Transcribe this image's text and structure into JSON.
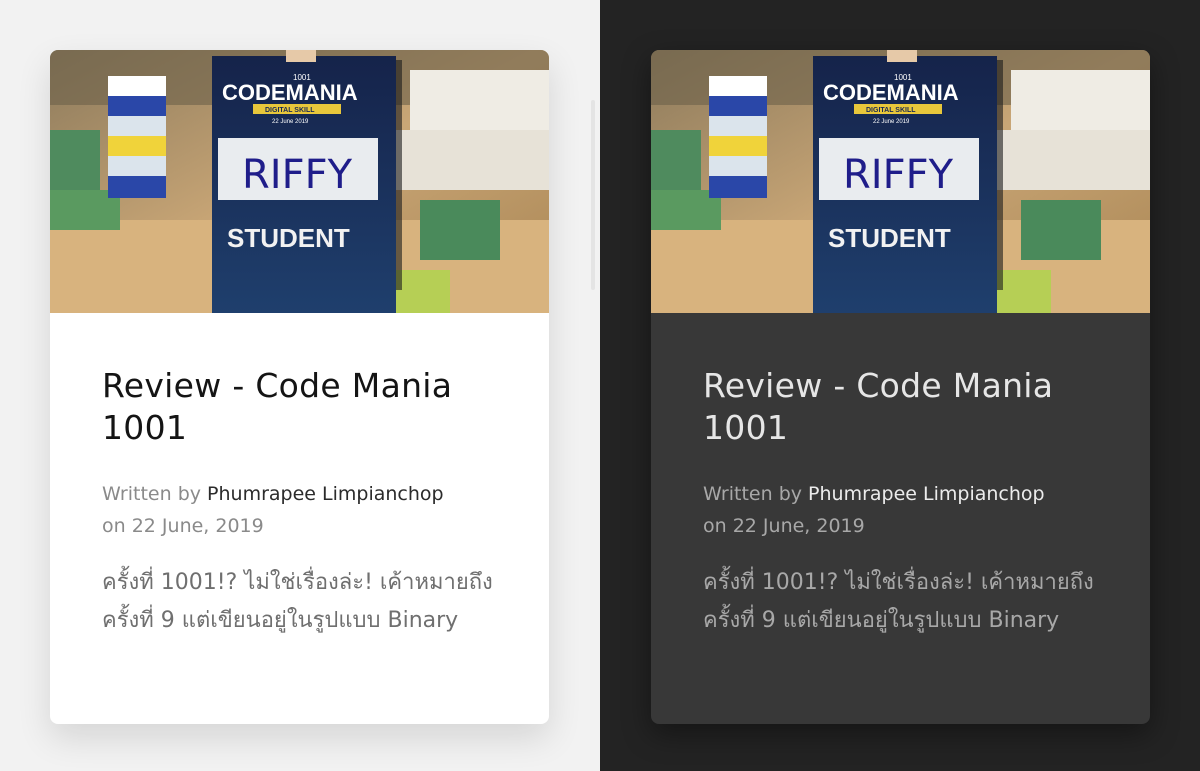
{
  "cards": [
    {
      "theme": "light",
      "image": {
        "badge_top": "1001",
        "badge_brand": "CODEMANIA",
        "badge_tagline": "DIGITAL SKILL",
        "badge_date": "22 June 2019",
        "badge_name": "RIFFY",
        "badge_role": "STUDENT"
      },
      "title": "Review - Code Mania 1001",
      "written_by": "Written by",
      "author": "Phumrapee Limpianchop",
      "date": "on 22 June, 2019",
      "excerpt": "ครั้งที่ 1001!? ไม่ใช่เรื่องล่ะ! เค้าหมายถึงครั้งที่ 9 แต่เขียนอยู่ในรูปแบบ Binary"
    },
    {
      "theme": "dark",
      "image": {
        "badge_top": "1001",
        "badge_brand": "CODEMANIA",
        "badge_tagline": "DIGITAL SKILL",
        "badge_date": "22 June 2019",
        "badge_name": "RIFFY",
        "badge_role": "STUDENT"
      },
      "title": "Review - Code Mania 1001",
      "written_by": "Written by",
      "author": "Phumrapee Limpianchop",
      "date": "on 22 June, 2019",
      "excerpt": "ครั้งที่ 1001!? ไม่ใช่เรื่องล่ะ! เค้าหมายถึงครั้งที่ 9 แต่เขียนอยู่ในรูปแบบ Binary"
    }
  ]
}
